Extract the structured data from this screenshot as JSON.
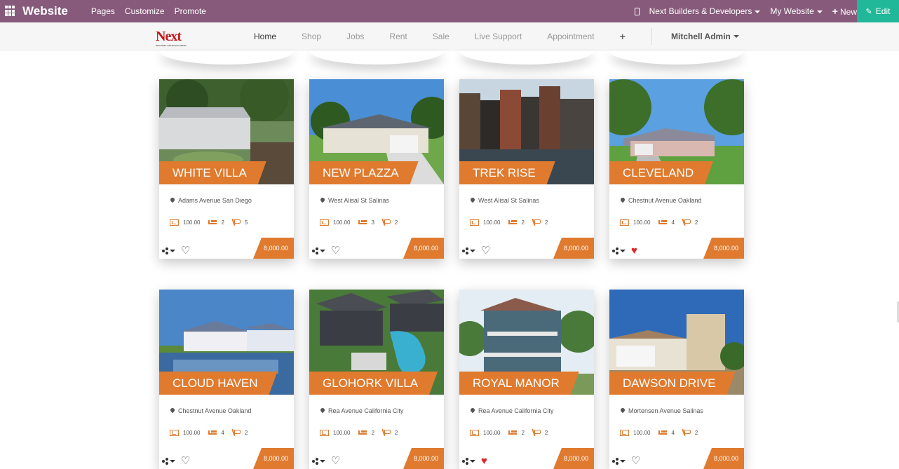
{
  "adminbar": {
    "brand": "Website",
    "menu": [
      "Pages",
      "Customize",
      "Promote"
    ],
    "company": "Next Builders & Developers",
    "my_website": "My Website",
    "new_label": "New",
    "edit_label": "Edit"
  },
  "header": {
    "logo_text": "Next",
    "logo_tagline": "BUILDERS AND DEVELOPERS",
    "nav": [
      "Home",
      "Shop",
      "Jobs",
      "Rent",
      "Sale",
      "Live Support",
      "Appointment"
    ],
    "user": "Mitchell Admin"
  },
  "colors": {
    "admin_bar": "#875a7b",
    "edit": "#21b799",
    "accent": "#e07a2e",
    "heart": "#e3262a"
  },
  "cards": [
    {
      "title": "WHITE VILLA",
      "address": "Adams Avenue San Diego",
      "area": "100.00",
      "beds": "2",
      "baths": "5",
      "price": "8,000.00",
      "favorite": false
    },
    {
      "title": "NEW PLAZZA",
      "address": "West Alisal St Salinas",
      "area": "100.00",
      "beds": "3",
      "baths": "2",
      "price": "8,000.00",
      "favorite": false
    },
    {
      "title": "TREK RISE",
      "address": "West Alisal St Salinas",
      "area": "100.00",
      "beds": "2",
      "baths": "2",
      "price": "8,000.00",
      "favorite": false
    },
    {
      "title": "CLEVELAND",
      "address": "Chestnut Avenue Oakland",
      "area": "100.00",
      "beds": "4",
      "baths": "2",
      "price": "8,000.00",
      "favorite": true
    },
    {
      "title": "CLOUD HAVEN",
      "address": "Chestnut Avenue Oakland",
      "area": "100.00",
      "beds": "4",
      "baths": "2",
      "price": "8,000.00",
      "favorite": false
    },
    {
      "title": "GLOHORK VILLA",
      "address": "Rea Avenue California City",
      "area": "100.00",
      "beds": "2",
      "baths": "2",
      "price": "8,000.00",
      "favorite": false
    },
    {
      "title": "ROYAL MANOR",
      "address": "Rea Avenue California City",
      "area": "100.00",
      "beds": "2",
      "baths": "2",
      "price": "8,000.00",
      "favorite": true
    },
    {
      "title": "DAWSON DRIVE",
      "address": "Mortensen Avenue Salinas",
      "area": "100.00",
      "beds": "4",
      "baths": "2",
      "price": "8,000.00",
      "favorite": false
    }
  ]
}
